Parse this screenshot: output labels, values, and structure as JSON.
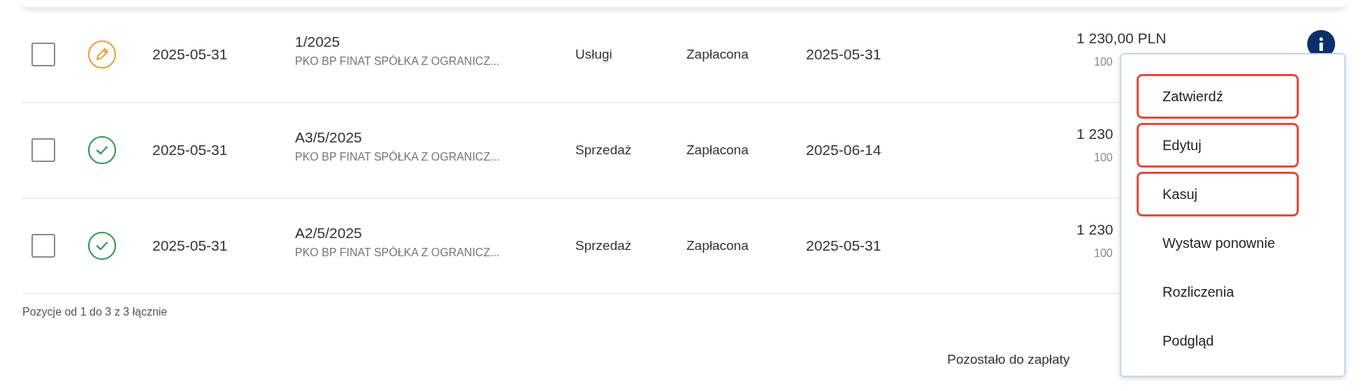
{
  "rows": [
    {
      "selected": false,
      "kind": "draft",
      "date": "2025-05-31",
      "number": "1/2025",
      "contractor": "PKO BP FINAT SPÓŁKA Z OGRANICZ...",
      "type": "Usługi",
      "status": "Zapłacona",
      "due_date": "2025-05-31",
      "amount": "1 230,00 PLN",
      "amount_sub": "100"
    },
    {
      "selected": false,
      "kind": "approved",
      "date": "2025-05-31",
      "number": "A3/5/2025",
      "contractor": "PKO BP FINAT SPÓŁKA Z OGRANICZ...",
      "type": "Sprzedaż",
      "status": "Zapłacona",
      "due_date": "2025-06-14",
      "amount": "1 230",
      "amount_sub": "100"
    },
    {
      "selected": false,
      "kind": "approved",
      "date": "2025-05-31",
      "number": "A2/5/2025",
      "contractor": "PKO BP FINAT SPÓŁKA Z OGRANICZ...",
      "type": "Sprzedaż",
      "status": "Zapłacona",
      "due_date": "2025-05-31",
      "amount": "1 230",
      "amount_sub": "100"
    }
  ],
  "pagination": {
    "summary": "Pozycje od 1 do 3 z 3 łącznie"
  },
  "remaining_label": "Pozostało do zapłaty",
  "context_menu": {
    "items": [
      {
        "label": "Zatwierdź",
        "highlighted": true
      },
      {
        "label": "Edytuj",
        "highlighted": true
      },
      {
        "label": "Kasuj",
        "highlighted": true
      },
      {
        "label": "Wystaw ponownie",
        "highlighted": false
      },
      {
        "label": "Rozliczenia",
        "highlighted": false
      },
      {
        "label": "Podgląd",
        "highlighted": false
      }
    ]
  }
}
